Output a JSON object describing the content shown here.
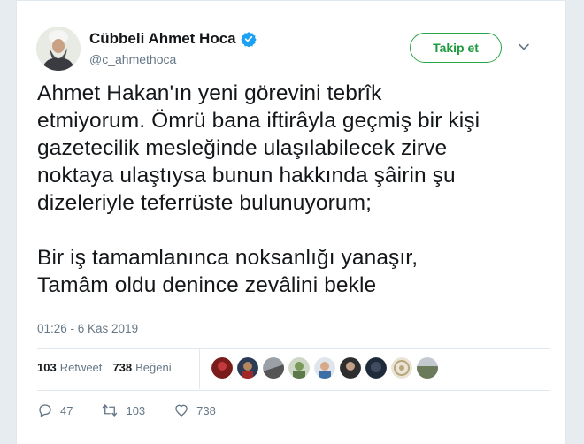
{
  "user": {
    "display_name": "Cübbeli Ahmet Hoca",
    "handle": "@c_ahmethoca",
    "follow_label": "Takip et"
  },
  "tweet": {
    "lines_para1": [
      "Ahmet Hakan'ın yeni görevini tebrîk",
      "etmiyorum. Ömrü bana iftirâyla geçmiş bir kişi",
      "gazetecilik mesleğinde ulaşılabilecek zirve",
      "noktaya ulaştıysa bunun hakkında şâirin şu",
      "dizeleriyle teferrüste bulunuyorum;"
    ],
    "lines_para2": [
      "Bir iş tamamlanınca noksanlığı yanaşır,",
      "Tamâm oldu denince zevâlini bekle"
    ],
    "timestamp": "01:26 - 6 Kas 2019"
  },
  "stats": {
    "retweets_count": "103",
    "retweets_label": "Retweet",
    "likes_count": "738",
    "likes_label": "Beğeni"
  },
  "actions": {
    "reply_count": "47",
    "retweet_count": "103",
    "like_count": "738"
  },
  "colors": {
    "follow_green": "#2aa548",
    "verified_blue": "#1da1f2",
    "muted": "#657786"
  },
  "icons": {
    "verified": "verified-badge-icon",
    "caret": "chevron-down-icon",
    "reply": "reply-icon",
    "retweet": "retweet-icon",
    "like": "heart-icon"
  }
}
